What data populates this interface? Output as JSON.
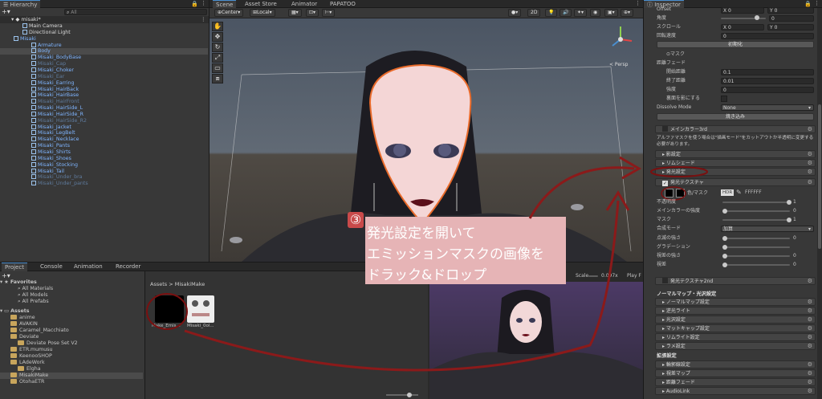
{
  "hierarchy": {
    "tab": "Hierarchy",
    "search_placeholder": "All",
    "scene": "misaki*",
    "rows": [
      {
        "label": "Main Camera",
        "style": "white",
        "indent": 2
      },
      {
        "label": "Directional Light",
        "style": "white",
        "indent": 2
      },
      {
        "label": "Misaki",
        "style": "blue",
        "indent": 1
      },
      {
        "label": "Armature",
        "style": "blue",
        "indent": 3
      },
      {
        "label": "Body",
        "style": "blue",
        "indent": 3,
        "selected": true
      },
      {
        "label": "Misaki_BodyBase",
        "style": "blue",
        "indent": 3
      },
      {
        "label": "Misaki_Cap",
        "style": "dim",
        "indent": 3
      },
      {
        "label": "Misaki_Choker",
        "style": "blue",
        "indent": 3
      },
      {
        "label": "Misaki_Ear",
        "style": "dim",
        "indent": 3
      },
      {
        "label": "Misaki_Earring",
        "style": "blue",
        "indent": 3
      },
      {
        "label": "Misaki_HairBack",
        "style": "blue",
        "indent": 3
      },
      {
        "label": "Misaki_HairBase",
        "style": "blue",
        "indent": 3
      },
      {
        "label": "Misaki_HairFront",
        "style": "dim",
        "indent": 3
      },
      {
        "label": "Misaki_HairSide_L",
        "style": "blue",
        "indent": 3
      },
      {
        "label": "Misaki_HairSide_R",
        "style": "blue",
        "indent": 3
      },
      {
        "label": "Misaki_HairSide_R2",
        "style": "dim",
        "indent": 3
      },
      {
        "label": "Misaki_Jacket",
        "style": "blue",
        "indent": 3
      },
      {
        "label": "Misaki_LegBelt",
        "style": "blue",
        "indent": 3
      },
      {
        "label": "Misaki_Necklace",
        "style": "blue",
        "indent": 3
      },
      {
        "label": "Misaki_Pants",
        "style": "blue",
        "indent": 3
      },
      {
        "label": "Misaki_Shirts",
        "style": "blue",
        "indent": 3
      },
      {
        "label": "Misaki_Shoes",
        "style": "blue",
        "indent": 3
      },
      {
        "label": "Misaki_Stocking",
        "style": "blue",
        "indent": 3
      },
      {
        "label": "Misaki_Tail",
        "style": "blue",
        "indent": 3
      },
      {
        "label": "Misaki_Under_bra",
        "style": "dim",
        "indent": 3
      },
      {
        "label": "Misaki_Under_pants",
        "style": "dim",
        "indent": 3
      }
    ]
  },
  "scene_tabs": [
    "Scene",
    "Asset Store",
    "Animator",
    "PAPATOO"
  ],
  "scene_toolbar": {
    "pivot": "Center",
    "space": "Local",
    "mode2d": "2D"
  },
  "gizmo": {
    "label": "< Persp"
  },
  "bottom_tabs": [
    "Project",
    "Console",
    "Animation",
    "Recorder"
  ],
  "project": {
    "favorites_title": "Favorites",
    "favorites": [
      "All Materials",
      "All Models",
      "All Prefabs"
    ],
    "assets_title": "Assets",
    "folders": [
      {
        "label": "anime",
        "indent": 1
      },
      {
        "label": "AVAKIN",
        "indent": 1
      },
      {
        "label": "Caramel_Macchiato",
        "indent": 1
      },
      {
        "label": "Deviate",
        "indent": 1
      },
      {
        "label": "Deviate Pose Set V2",
        "indent": 2
      },
      {
        "label": "ETR.mumusu",
        "indent": 1
      },
      {
        "label": "KeenooSHOP",
        "indent": 1
      },
      {
        "label": "LAdeWork",
        "indent": 1
      },
      {
        "label": "Elgha",
        "indent": 2
      },
      {
        "label": "MisakiMake",
        "indent": 1,
        "selected": true
      },
      {
        "label": "OtohaETR",
        "indent": 1
      }
    ],
    "breadcrumb": [
      "Assets",
      "MisakiMake"
    ],
    "files": [
      "Make_Emis...",
      "Misaki_0ol..."
    ]
  },
  "game": {
    "scale_label": "Scale",
    "scale_value": "0.097x",
    "play_label": "Play F"
  },
  "annotation": {
    "number": "③",
    "lines": [
      "発光設定を開いて",
      "エミッションマスクの画像を",
      "ドラック&ドロップ"
    ]
  },
  "inspector": {
    "tab": "Inspector",
    "top_rows": [
      {
        "label": "Offset",
        "x": "0",
        "y": "0"
      }
    ],
    "angle": {
      "label": "角度",
      "value": "0"
    },
    "scroll": {
      "label": "スクロール",
      "x": "0",
      "y": "0"
    },
    "rot_speed": {
      "label": "回転速度",
      "value": "0"
    },
    "init_button": "初期化",
    "mask_label": "マスク",
    "dist_fade": {
      "title": "距離フェード",
      "start_label": "開始距離",
      "start": "0.1",
      "end_label": "終了距離",
      "end": "0.01",
      "strength_label": "強度",
      "strength": "0",
      "backface_label": "裏面を影にする"
    },
    "dissolve": {
      "label": "Dissolve Mode",
      "value": "None"
    },
    "bake_button": "焼き込み",
    "main3rd": "メインカラー3rd",
    "alpha_note": "アルファマスクを使う場合は\"描画モード\"をカットアウトか半透明に変更する必要があります。",
    "sections_a": [
      "影設定",
      "リムシェード",
      "発光設定"
    ],
    "emission": {
      "title": "発光テクスチャ",
      "tex_label": "色",
      "mask_label": "マスク",
      "hdr": "HDR",
      "hex": "FFFFFF",
      "rows": [
        {
          "label": "不透明度",
          "value": "1"
        },
        {
          "label": "メインカラーの強度",
          "value": "0"
        },
        {
          "label": "マスク",
          "value": "1"
        }
      ],
      "blend_label": "合成モード",
      "blend_value": "加算",
      "rows2": [
        {
          "label": "点滅の強さ",
          "value": "0"
        },
        {
          "label": "グラデーション",
          "value": ""
        },
        {
          "label": "視差の強さ",
          "value": "0"
        },
        {
          "label": "視差",
          "value": "0"
        }
      ]
    },
    "emission2nd": "発光テクスチャ2nd",
    "normal_title": "ノーマルマップ・光沢設定",
    "normal_sections": [
      "ノーマルマップ設定",
      "逆光ライト",
      "光沢設定",
      "マットキャップ設定",
      "リムライト設定",
      "ラメ設定"
    ],
    "ext_title": "拡張設定",
    "ext_sections": [
      "輪郭線設定",
      "視差マップ",
      "距離フェード",
      "AudioLink"
    ]
  },
  "colors": {
    "accent": "#4a8fd0",
    "annotation_bg": "#e6b4b6",
    "arrow": "#8b1a1a"
  }
}
